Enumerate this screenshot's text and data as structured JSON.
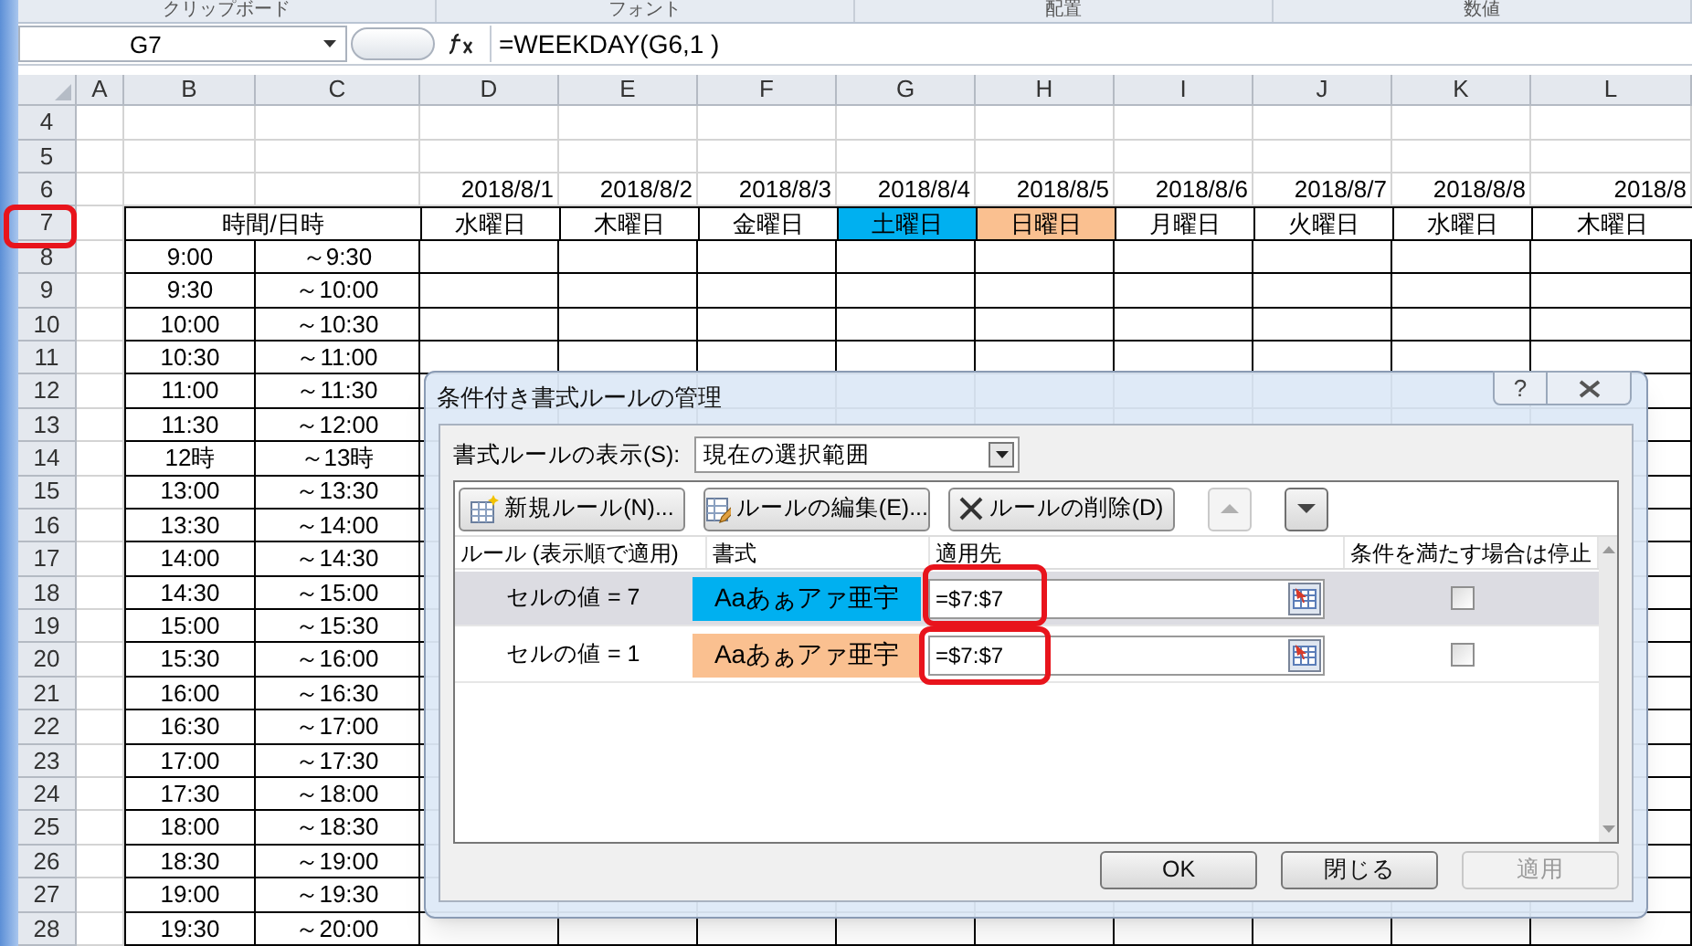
{
  "ribbon_groups": [
    "クリップボード",
    "フォント",
    "配置",
    "数値"
  ],
  "formula_bar": {
    "name_box": "G7",
    "formula": "=WEEKDAY(G6,1 )"
  },
  "sheet": {
    "columns": [
      "A",
      "B",
      "C",
      "D",
      "E",
      "F",
      "G",
      "H",
      "I",
      "J",
      "K",
      "L"
    ],
    "rows": [
      {
        "kind": "blank",
        "number": "4"
      },
      {
        "kind": "blank",
        "number": "5"
      },
      {
        "kind": "dates",
        "number": "6",
        "dates": [
          "2018/8/1",
          "2018/8/2",
          "2018/8/3",
          "2018/8/4",
          "2018/8/5",
          "2018/8/6",
          "2018/8/7",
          "2018/8/8",
          "2018/8"
        ]
      },
      {
        "kind": "header",
        "number": "7",
        "label": "時間/日時",
        "weekdays": [
          {
            "text": "水曜日"
          },
          {
            "text": "木曜日"
          },
          {
            "text": "金曜日"
          },
          {
            "text": "土曜日",
            "color": "#00b0f0"
          },
          {
            "text": "日曜日",
            "color": "#fac090"
          },
          {
            "text": "月曜日"
          },
          {
            "text": "火曜日"
          },
          {
            "text": "水曜日"
          },
          {
            "text": "木曜日"
          }
        ]
      },
      {
        "kind": "time",
        "number": "8",
        "start": "9:00",
        "end": "～9:30"
      },
      {
        "kind": "time",
        "number": "9",
        "start": "9:30",
        "end": "～10:00"
      },
      {
        "kind": "time",
        "number": "10",
        "start": "10:00",
        "end": "～10:30"
      },
      {
        "kind": "time",
        "number": "11",
        "start": "10:30",
        "end": "～11:00"
      },
      {
        "kind": "time",
        "number": "12",
        "start": "11:00",
        "end": "～11:30"
      },
      {
        "kind": "time",
        "number": "13",
        "start": "11:30",
        "end": "～12:00"
      },
      {
        "kind": "time",
        "number": "14",
        "start": "12時",
        "end": "～13時"
      },
      {
        "kind": "time",
        "number": "15",
        "start": "13:00",
        "end": "～13:30"
      },
      {
        "kind": "time",
        "number": "16",
        "start": "13:30",
        "end": "～14:00"
      },
      {
        "kind": "time",
        "number": "17",
        "start": "14:00",
        "end": "～14:30"
      },
      {
        "kind": "time",
        "number": "18",
        "start": "14:30",
        "end": "～15:00"
      },
      {
        "kind": "time",
        "number": "19",
        "start": "15:00",
        "end": "～15:30"
      },
      {
        "kind": "time",
        "number": "20",
        "start": "15:30",
        "end": "～16:00"
      },
      {
        "kind": "time",
        "number": "21",
        "start": "16:00",
        "end": "～16:30"
      },
      {
        "kind": "time",
        "number": "22",
        "start": "16:30",
        "end": "～17:00"
      },
      {
        "kind": "time",
        "number": "23",
        "start": "17:00",
        "end": "～17:30"
      },
      {
        "kind": "time",
        "number": "24",
        "start": "17:30",
        "end": "～18:00"
      },
      {
        "kind": "time",
        "number": "25",
        "start": "18:00",
        "end": "～18:30"
      },
      {
        "kind": "time",
        "number": "26",
        "start": "18:30",
        "end": "～19:00"
      },
      {
        "kind": "time",
        "number": "27",
        "start": "19:00",
        "end": "～19:30"
      },
      {
        "kind": "time",
        "number": "28",
        "start": "19:30",
        "end": "～20:00"
      }
    ]
  },
  "dialog": {
    "title": "条件付き書式ルールの管理",
    "help": "?",
    "show_rules_label": "書式ルールの表示(S):",
    "show_rules_value": "現在の選択範囲",
    "toolbar": [
      {
        "kind": "new",
        "label": "新規ルール(N)..."
      },
      {
        "kind": "edit",
        "label": "ルールの編集(E)..."
      },
      {
        "kind": "delete",
        "label": "ルールの削除(D)"
      },
      {
        "kind": "up",
        "disabled": true
      },
      {
        "kind": "down",
        "disabled": false
      }
    ],
    "columns": [
      "ルール (表示順で適用)",
      "書式",
      "適用先",
      "条件を満たす場合は停止"
    ],
    "rules": [
      {
        "rule": "セルの値 = 7",
        "preview": "Aaあぁアァ亜宇",
        "color": "#00b0f0",
        "applies_to": "=$7:$7",
        "stop": false,
        "selected": true
      },
      {
        "rule": "セルの値 = 1",
        "preview": "Aaあぁアァ亜宇",
        "color": "#fac090",
        "applies_to": "=$7:$7",
        "stop": false,
        "selected": false
      }
    ],
    "buttons": [
      {
        "label": "OK",
        "disabled": false
      },
      {
        "label": "閉じる",
        "disabled": false
      },
      {
        "label": "適用",
        "disabled": true
      }
    ]
  }
}
